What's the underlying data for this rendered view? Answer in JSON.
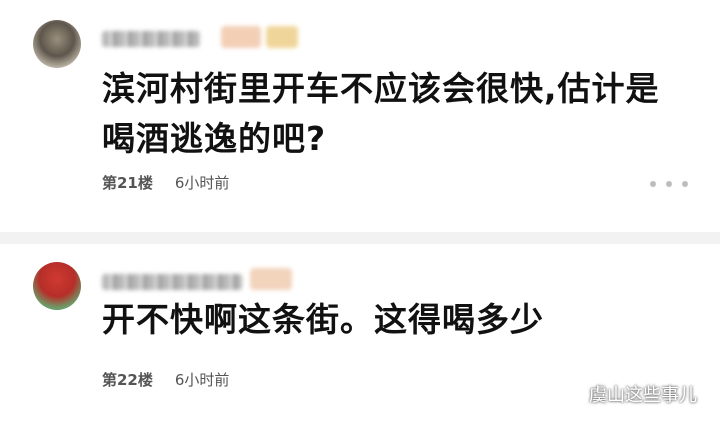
{
  "comments": [
    {
      "text": "滨河村街里开车不应该会很快,估计是喝酒逃逸的吧?",
      "floor": "第21楼",
      "time": "6小时前"
    },
    {
      "text": "开不快啊这条街。这得喝多少",
      "floor": "第22楼",
      "time": "6小时前"
    }
  ],
  "more_icon": "ellipsis-icon",
  "watermark": {
    "icon": "wechat-icon",
    "text": "虞山这些事儿"
  },
  "colors": {
    "background": "#ffffff",
    "divider": "#f2f2f2",
    "meta_text": "#555555",
    "dots": "#bdbdbd"
  }
}
